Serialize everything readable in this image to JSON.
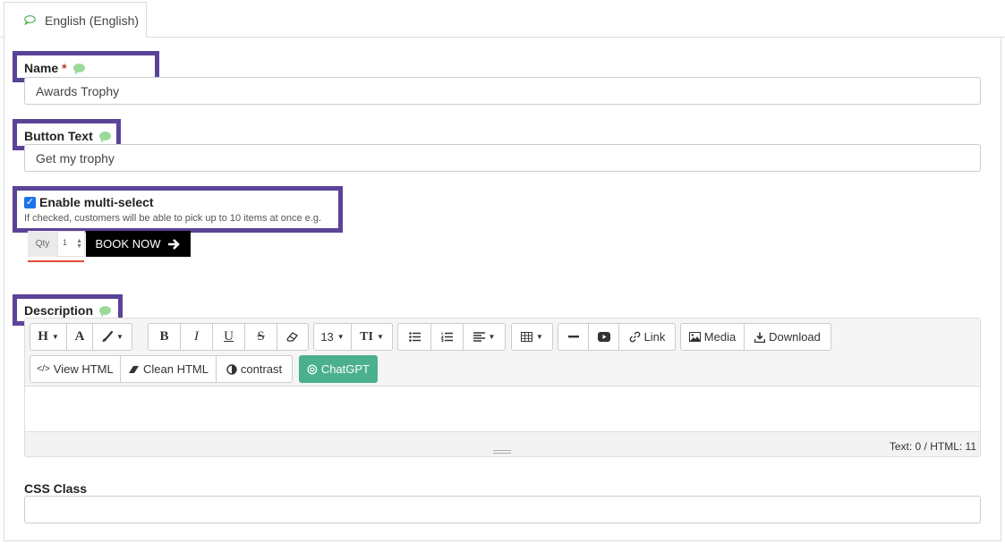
{
  "tab": {
    "label": "English (English)"
  },
  "fields": {
    "name": {
      "label": "Name",
      "required": "*",
      "value": "Awards Trophy"
    },
    "button_text": {
      "label": "Button Text",
      "value": "Get my trophy"
    },
    "multi_select": {
      "label": "Enable multi-select",
      "checked": true,
      "help": "If checked, customers will be able to pick up to 10 items at once e.g."
    },
    "preview": {
      "qty_label": "Qty",
      "qty_value": "1",
      "button_label": "BOOK NOW"
    },
    "description": {
      "label": "Description"
    },
    "css_class": {
      "label": "CSS Class",
      "value": ""
    }
  },
  "editor": {
    "toolbar_row1": {
      "heading": "H",
      "font_color": "A",
      "font_size": "13",
      "line_height": "TI",
      "link": "Link",
      "media": "Media",
      "download": "Download"
    },
    "toolbar_row2": {
      "view_html": "View HTML",
      "clean_html": "Clean HTML",
      "contrast": "contrast",
      "chatgpt": "ChatGPT"
    },
    "status": "Text: 0 / HTML: 11"
  },
  "colors": {
    "highlight_border": "#5b4398",
    "chatgpt": "#4bb08e",
    "required": "#c0392b",
    "translate_bubble": "#9ad99a"
  }
}
